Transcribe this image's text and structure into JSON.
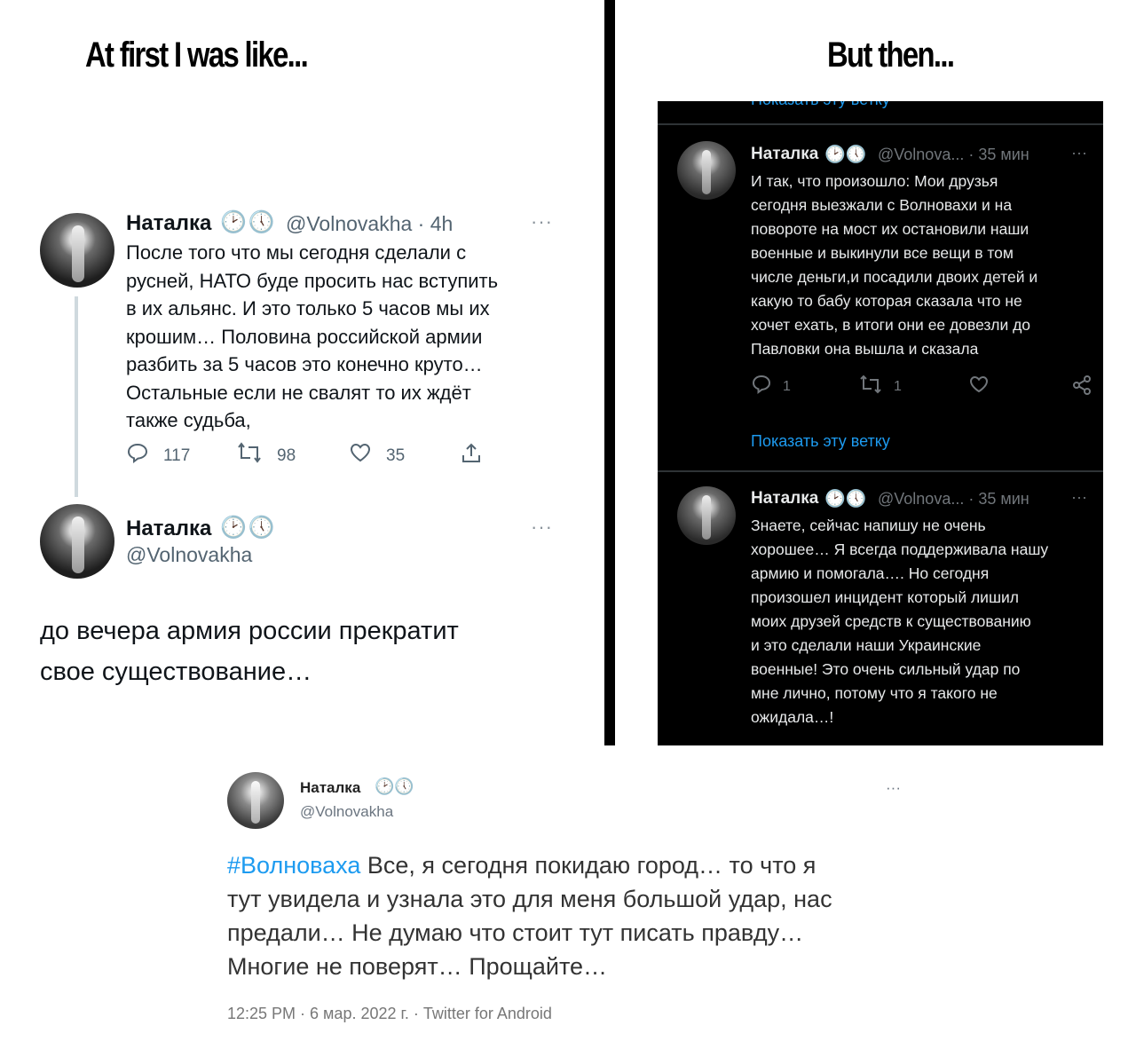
{
  "headings": {
    "left": "At first I was like...",
    "right": "But then..."
  },
  "left_tweet_1": {
    "name": "Наталка",
    "clocks": "🕑🕔",
    "handle_time": "@Volnovakha · 4h",
    "more": "···",
    "text_lines": [
      "После того что мы сегодня сделали с",
      "русней, НАТО буде просить нас вступить",
      "в их альянс. И это только 5 часов мы их",
      "крошим… Половина российской армии",
      "разбить за 5 часов это конечно круто…",
      "Остальные если не свалят то их ждёт",
      "также судьба,"
    ],
    "replies": "117",
    "retweets": "98",
    "likes": "35"
  },
  "left_tweet_2": {
    "name": "Наталка",
    "clocks": "🕑🕔",
    "handle": "@Volnovakha",
    "more": "···",
    "text_lines": [
      "до вечера армия россии прекратит",
      "свое существование…"
    ]
  },
  "dark_panel": {
    "top_link_fragment": "Показать эту ветку",
    "tweet_1": {
      "name": "Наталка",
      "clocks": "🕑🕔",
      "meta": "@Volnova... · 35 мин",
      "more": "···",
      "text_lines": [
        "И так, что произошло: Мои друзья",
        "сегодня выезжали с Волновахи и на",
        "повороте на мост их остановили наши",
        "военные и выкинули все вещи в том",
        "числе деньги,и посадили двоих детей и",
        "какую то бабу которая сказала что не",
        "хочет ехать, в итоги они ее довезли до",
        "Павловки она вышла и сказала"
      ],
      "replies": "1",
      "retweets": "1",
      "show_thread": "Показать эту ветку"
    },
    "tweet_2": {
      "name": "Наталка",
      "clocks": "🕑🕔",
      "meta": "@Volnova... · 35 мин",
      "more": "···",
      "text_lines": [
        "Знаете, сейчас напишу не очень",
        "хорошее… Я всегда поддерживала нашу",
        "армию и помогала…. Но сегодня",
        "произошел инцидент который лишил",
        "моих друзей средств к существованию",
        "и это сделали наши Украинские",
        "военные! Это очень сильный удар по",
        "мне лично, потому что я такого не",
        "ожидала…!"
      ]
    }
  },
  "bottom_tweet": {
    "name": "Наталка",
    "clocks": "🕑🕔",
    "handle": "@Volnovakha",
    "more": "···",
    "hashtag": "#Волноваха",
    "line1_rest": " Все, я сегодня покидаю город… то что я",
    "text_lines": [
      "тут увидела и узнала это для меня большой удар, нас",
      "предали… Не думаю что стоит тут писать правду…",
      "Многие не поверят…  Прощайте…"
    ],
    "footer": "12:25 PM · 6 мар. 2022 г. · Twitter for Android"
  },
  "icons": [
    "reply-icon",
    "retweet-icon",
    "like-icon",
    "share-icon",
    "more-icon",
    "clock-icon"
  ],
  "colors": {
    "link_blue": "#1d9bf0",
    "dark_bg": "#000000",
    "muted_gray": "#536471"
  }
}
